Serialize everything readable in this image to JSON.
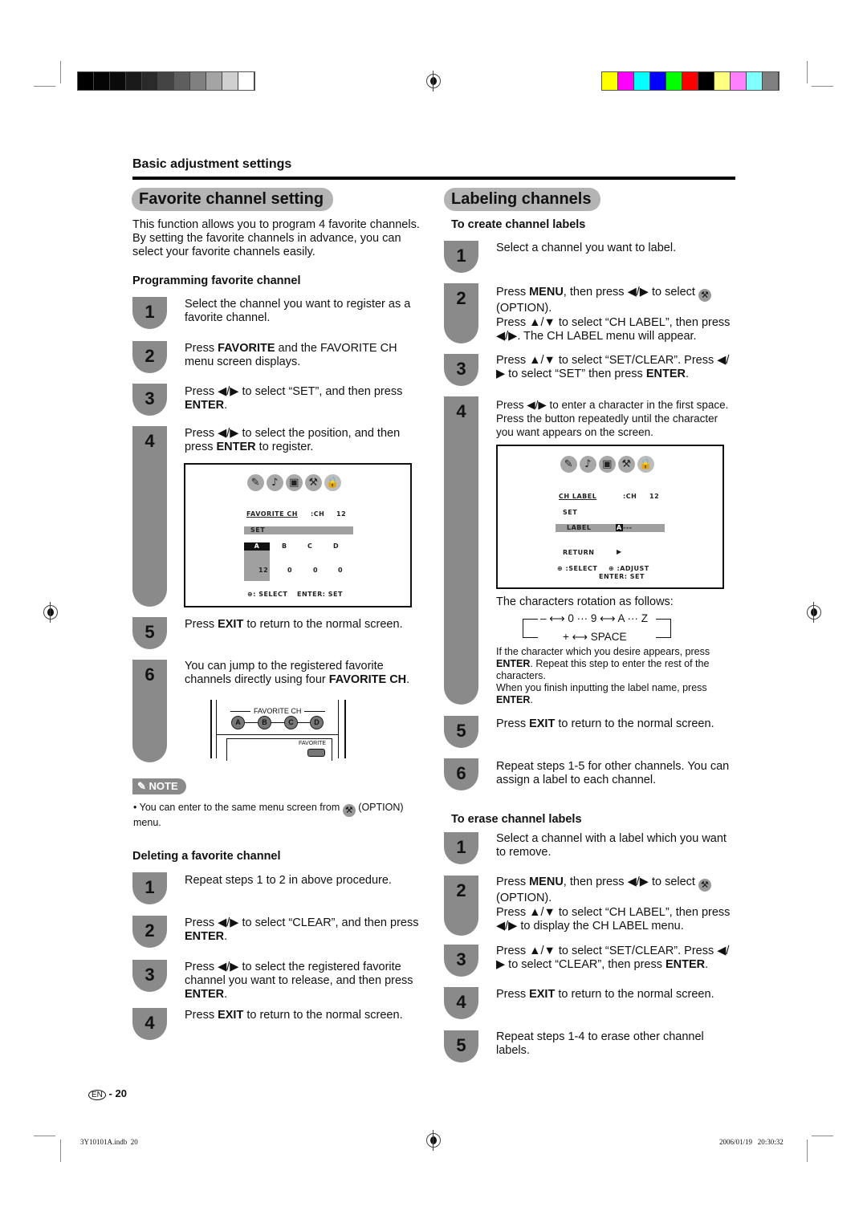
{
  "header": {
    "section_title": "Basic adjustment settings"
  },
  "colors": {
    "grayscale_bar": [
      "#000000",
      "#050505",
      "#0a0a0a",
      "#1a1a1a",
      "#2a2a2a",
      "#444444",
      "#5e5e5e",
      "#808080",
      "#a4a4a4",
      "#d0d0d0",
      "#ffffff"
    ],
    "color_bar": [
      "#ffff00",
      "#ff00ff",
      "#00ffff",
      "#0000ff",
      "#00ff00",
      "#ff0000",
      "#000000",
      "#ffff80",
      "#ff80ff",
      "#80ffff",
      "#808080"
    ],
    "step_badge": "#8a8a8a",
    "title_pill": "#b4b4b4"
  },
  "favorite": {
    "title": "Favorite channel setting",
    "intro": "This function allows you to program 4 favorite channels. By setting the favorite channels in advance, you can select your favorite channels easily.",
    "programming": {
      "heading": "Programming favorite channel",
      "steps": [
        {
          "num": "1",
          "text": "Select the channel you want to register as a favorite channel."
        },
        {
          "num": "2",
          "pre": "Press ",
          "bold": "FAVORITE",
          "post": " and the FAVORITE CH menu screen displays."
        },
        {
          "num": "3",
          "pre": "Press ◀/▶ to select “SET”, and then press ",
          "bold": "ENTER",
          "post": "."
        },
        {
          "num": "4",
          "pre": "Press ◀/▶ to select the position, and then press ",
          "bold": "ENTER",
          "post": " to register."
        },
        {
          "num": "5",
          "pre": "Press ",
          "bold": "EXIT",
          "post": " to return to the normal screen."
        },
        {
          "num": "6",
          "pre": "You can jump to the registered favorite channels directly using four ",
          "bold": "FAVORITE CH",
          "post": "."
        }
      ]
    },
    "screen": {
      "menu_title": "FAVORITE CH",
      "ch_label": ":CH",
      "ch_value": "12",
      "set_row": "SET",
      "slots": [
        "A",
        "B",
        "C",
        "D"
      ],
      "slot_values": [
        "12",
        "0",
        "0",
        "0"
      ],
      "footer_select": ": SELECT",
      "footer_enter": "ENTER: SET"
    },
    "remote": {
      "label": "FAVORITE CH",
      "buttons": [
        "A",
        "B",
        "C",
        "D"
      ],
      "favorite_label": "FAVORITE"
    },
    "note": {
      "badge": "NOTE",
      "text_pre": "You can enter to the same menu screen from",
      "text_post": "(OPTION) menu."
    },
    "deleting": {
      "heading": "Deleting a favorite channel",
      "steps": [
        {
          "num": "1",
          "text": "Repeat steps 1 to 2 in above procedure."
        },
        {
          "num": "2",
          "pre": "Press ◀/▶ to select “CLEAR”, and then press ",
          "bold": "ENTER",
          "post": "."
        },
        {
          "num": "3",
          "pre": "Press ◀/▶ to select the registered favorite channel you want to release, and then press ",
          "bold": "ENTER",
          "post": "."
        },
        {
          "num": "4",
          "pre": "Press ",
          "bold": "EXIT",
          "post": " to return to the normal screen."
        }
      ]
    }
  },
  "labeling": {
    "title": "Labeling channels",
    "create": {
      "heading": "To create channel labels",
      "steps": [
        {
          "num": "1",
          "text": "Select a channel you want to label."
        },
        {
          "num": "2",
          "pre": "Press ",
          "bold": "MENU",
          "post": ", then press ◀/▶ to select",
          "post2": "(OPTION).",
          "extra": "Press ▲/▼ to select “CH LABEL”, then press ◀/▶. The CH LABEL menu will appear."
        },
        {
          "num": "3",
          "pre": "Press ▲/▼ to select “SET/CLEAR”. Press ◀/▶ to select “SET” then press ",
          "bold": "ENTER",
          "post": "."
        },
        {
          "num": "4",
          "text": "Press ◀/▶ to enter a character in the first space. Press the button repeatedly until the character you want appears on the screen."
        },
        {
          "num": "5",
          "pre": "Press ",
          "bold": "EXIT",
          "post": " to return to the normal screen."
        },
        {
          "num": "6",
          "text": "Repeat steps 1-5 for other channels. You can assign a label to each channel."
        }
      ]
    },
    "screen": {
      "menu_title": "CH LABEL",
      "ch_label": ":CH",
      "ch_value": "12",
      "set_row": "SET",
      "label_row": "LABEL",
      "label_cursor": "A",
      "label_rest": "---",
      "return_row": "RETURN",
      "footer_select": ":SELECT",
      "footer_adjust": ":ADJUST",
      "footer_enter": "ENTER: SET"
    },
    "rotation": {
      "intro": "The characters rotation as follows:",
      "line1": "– ⟷ 0 ··· 9 ⟷ A ··· Z",
      "line2": "+ ⟷ SPACE"
    },
    "enter_note1_bold": "ENTER",
    "enter_note1_pre": "If the character which you desire appears, press",
    "enter_note1_post": ". Repeat this step to enter the rest of the characters.",
    "enter_note2_pre": "When you finish inputting the label name, press",
    "enter_note2_bold": "ENTER",
    "erase": {
      "heading": "To erase channel labels",
      "steps": [
        {
          "num": "1",
          "text": "Select a channel with a label which you want to remove."
        },
        {
          "num": "2",
          "pre": "Press ",
          "bold": "MENU",
          "post": ", then press ◀/▶ to select",
          "post2": "(OPTION).",
          "extra": "Press ▲/▼ to select “CH LABEL”, then press ◀/▶ to display the CH LABEL menu."
        },
        {
          "num": "3",
          "pre": "Press ▲/▼ to select “SET/CLEAR”. Press ◀/▶ to select “CLEAR”, then press ",
          "bold": "ENTER",
          "post": "."
        },
        {
          "num": "4",
          "pre": "Press ",
          "bold": "EXIT",
          "post": " to return to the normal screen."
        },
        {
          "num": "5",
          "text": "Repeat steps 1-4 to erase other channel labels."
        }
      ]
    }
  },
  "footer": {
    "lang": "EN",
    "page": "- 20",
    "file": "3Y10101A.indb  20",
    "timestamp": "2006/01/19   20:30:32"
  },
  "icons": {
    "menu": [
      "picture-icon",
      "audio-icon",
      "power-icon",
      "option-icon",
      "lock-icon"
    ],
    "glyphs": [
      "✎",
      "♪",
      "▣",
      "⚒",
      "🔒"
    ]
  }
}
